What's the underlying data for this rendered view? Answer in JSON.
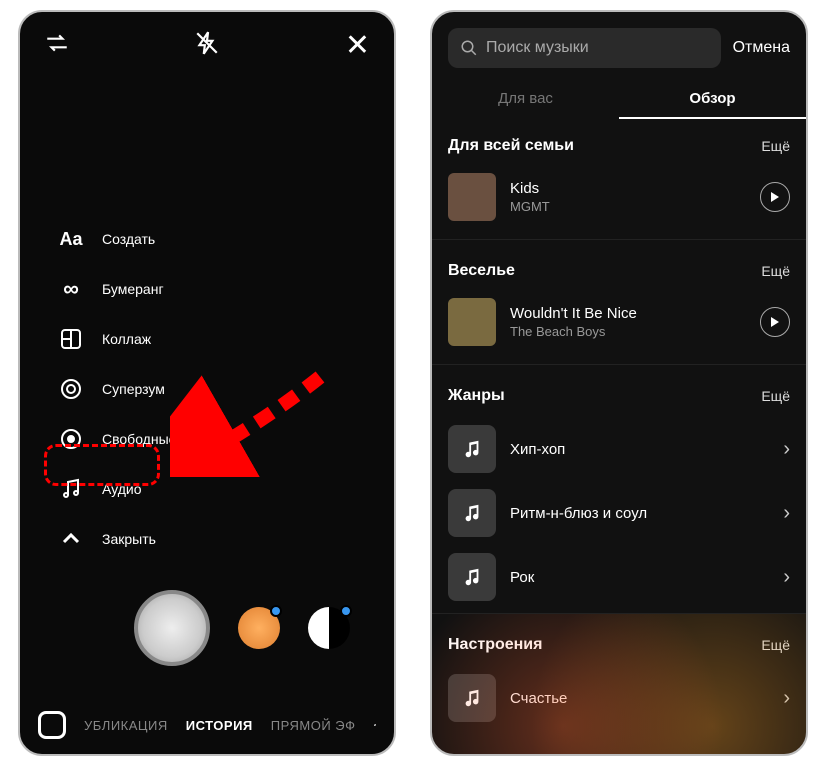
{
  "left": {
    "menu": {
      "create": "Создать",
      "boomerang": "Бумеранг",
      "collage": "Коллаж",
      "superzoom": "Суперзум",
      "handsfree": "Свободные руки",
      "audio": "Аудио",
      "close": "Закрыть"
    },
    "modes": {
      "publication": "УБЛИКАЦИЯ",
      "story": "ИСТОРИЯ",
      "live": "ПРЯМОЙ ЭФ"
    }
  },
  "right": {
    "search": {
      "placeholder": "Поиск музыки",
      "cancel": "Отмена"
    },
    "tabs": {
      "for_you": "Для вас",
      "browse": "Обзор"
    },
    "sections": {
      "family": {
        "title": "Для всей семьи",
        "more": "Ещё"
      },
      "fun": {
        "title": "Веселье",
        "more": "Ещё"
      },
      "genres": {
        "title": "Жанры",
        "more": "Ещё"
      },
      "moods": {
        "title": "Настроения",
        "more": "Ещё"
      }
    },
    "tracks": {
      "kids": {
        "title": "Kids",
        "artist": "MGMT"
      },
      "nice": {
        "title": "Wouldn't It Be Nice",
        "artist": "The Beach Boys"
      }
    },
    "genres": {
      "hiphop": "Хип-хоп",
      "rnb": "Ритм-н-блюз и соул",
      "rock": "Рок"
    },
    "moods": {
      "happy": "Счастье"
    }
  }
}
